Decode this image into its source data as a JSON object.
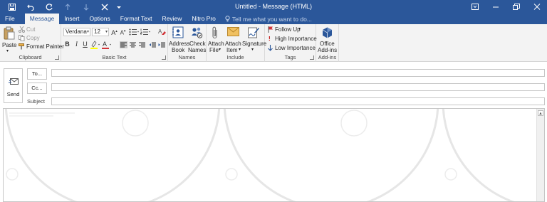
{
  "window": {
    "title": "Untitled - Message (HTML)"
  },
  "tabs": {
    "file": "File",
    "message": "Message",
    "insert": "Insert",
    "options": "Options",
    "format_text": "Format Text",
    "review": "Review",
    "nitro_pro": "Nitro Pro"
  },
  "tell_me": "Tell me what you want to do...",
  "clipboard": {
    "paste": "Paste",
    "cut": "Cut",
    "copy": "Copy",
    "format_painter": "Format Painter",
    "group": "Clipboard"
  },
  "basic_text": {
    "font": "Verdana",
    "size": "12",
    "group": "Basic Text",
    "bold": "B",
    "italic": "I",
    "underline": "U"
  },
  "names": {
    "address_book_1": "Address",
    "address_book_2": "Book",
    "check_names_1": "Check",
    "check_names_2": "Names",
    "group": "Names"
  },
  "include": {
    "attach_file_1": "Attach",
    "attach_file_2": "File",
    "attach_item_1": "Attach",
    "attach_item_2": "Item",
    "signature_1": "Signature",
    "group": "Include"
  },
  "tags": {
    "follow_up": "Follow Up",
    "high_importance": "High Importance",
    "low_importance": "Low Importance",
    "group": "Tags"
  },
  "addins": {
    "office_1": "Office",
    "office_2": "Add-ins",
    "group": "Add-ins"
  },
  "compose": {
    "send": "Send",
    "to": "To...",
    "cc": "Cc...",
    "subject": "Subject",
    "to_value": "",
    "cc_value": "",
    "subject_value": ""
  },
  "colors": {
    "titlebar": "#2b579a",
    "ribbon": "#f3f3f3",
    "flag": "#d13438",
    "importance_high": "#c00000",
    "importance_low": "#2b579a"
  }
}
